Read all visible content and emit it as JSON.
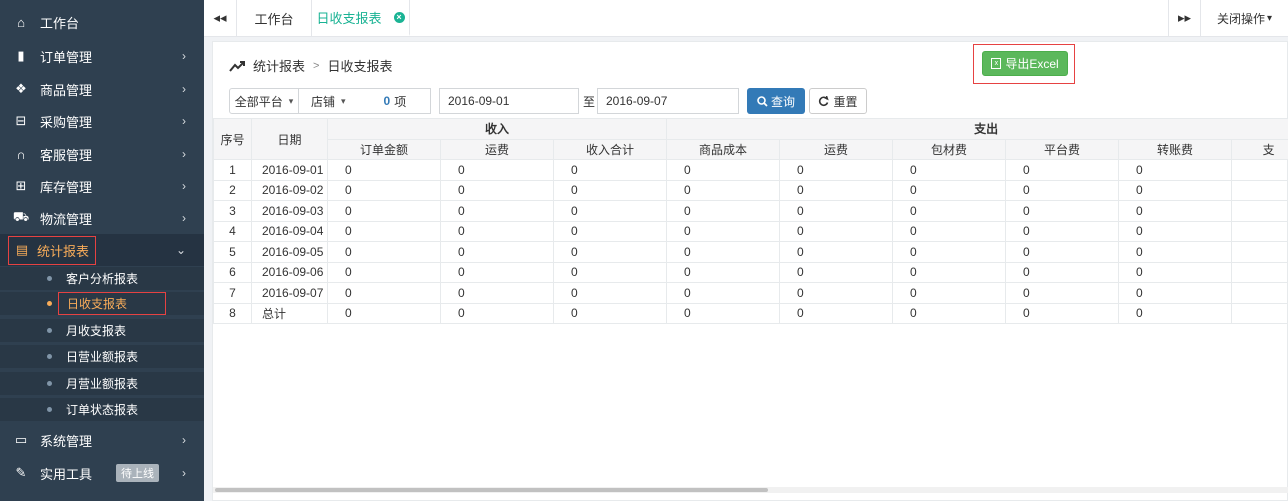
{
  "sidebar": {
    "items": [
      {
        "label": "工作台",
        "icon": "home-icon",
        "glyph": "⌂",
        "has_arrow": false
      },
      {
        "label": "订单管理",
        "icon": "clipboard-icon",
        "glyph": "▮",
        "has_arrow": true,
        "arrow": "›"
      },
      {
        "label": "商品管理",
        "icon": "gift-icon",
        "glyph": "❖",
        "has_arrow": true,
        "arrow": "›"
      },
      {
        "label": "采购管理",
        "icon": "cart-icon",
        "glyph": "⊟",
        "has_arrow": true,
        "arrow": "›"
      },
      {
        "label": "客服管理",
        "icon": "headphones-icon",
        "glyph": "∩",
        "has_arrow": true,
        "arrow": "›"
      },
      {
        "label": "库存管理",
        "icon": "inbox-icon",
        "glyph": "⊞",
        "has_arrow": true,
        "arrow": "›"
      },
      {
        "label": "物流管理",
        "icon": "truck-icon",
        "glyph": "⛟",
        "has_arrow": true,
        "arrow": "›"
      },
      {
        "label": "统计报表",
        "icon": "report-icon",
        "glyph": "▤",
        "has_arrow": true,
        "arrow": "⌄",
        "active": true
      }
    ],
    "subitems": [
      {
        "label": "客户分析报表"
      },
      {
        "label": "日收支报表",
        "active": true
      },
      {
        "label": "月收支报表"
      },
      {
        "label": "日营业额报表"
      },
      {
        "label": "月营业额报表"
      },
      {
        "label": "订单状态报表"
      }
    ],
    "bottom_items": [
      {
        "label": "系统管理",
        "icon": "monitor-icon",
        "glyph": "▭",
        "arrow": "›"
      },
      {
        "label": "实用工具",
        "icon": "wrench-icon",
        "glyph": "✎",
        "arrow": "›",
        "badge": "待上线"
      }
    ]
  },
  "topbar": {
    "back_glyph": "◂◂",
    "forward_glyph": "▸▸",
    "tabs": [
      {
        "label": "工作台"
      },
      {
        "label": "日收支报表",
        "close_glyph": "×"
      }
    ],
    "close_ops_label": "关闭操作",
    "close_ops_caret": "▾"
  },
  "breadcrumb": {
    "parent": "统计报表",
    "separator": ">",
    "current": "日收支报表"
  },
  "export": {
    "label": "导出Excel",
    "icon_glyph": "x"
  },
  "filters": {
    "platform": "全部平台",
    "shop": "店铺",
    "shop_count": "0",
    "shop_count_unit": "项",
    "date_from": "2016-09-01",
    "to_label": "至",
    "date_to": "2016-09-07",
    "search_label": "查询",
    "reset_label": "重置",
    "caret": "▾"
  },
  "table": {
    "col_seq": "序号",
    "col_date": "日期",
    "group_income": "收入",
    "group_expense": "支出",
    "income_cols": [
      "订单金额",
      "运费",
      "收入合计"
    ],
    "expense_cols": [
      "商品成本",
      "运费",
      "包材费",
      "平台费",
      "转账费",
      "支"
    ],
    "rows": [
      {
        "seq": "1",
        "date": "2016-09-01",
        "vals": [
          "0",
          "0",
          "0",
          "0",
          "0",
          "0",
          "0",
          "0"
        ]
      },
      {
        "seq": "2",
        "date": "2016-09-02",
        "vals": [
          "0",
          "0",
          "0",
          "0",
          "0",
          "0",
          "0",
          "0"
        ]
      },
      {
        "seq": "3",
        "date": "2016-09-03",
        "vals": [
          "0",
          "0",
          "0",
          "0",
          "0",
          "0",
          "0",
          "0"
        ]
      },
      {
        "seq": "4",
        "date": "2016-09-04",
        "vals": [
          "0",
          "0",
          "0",
          "0",
          "0",
          "0",
          "0",
          "0"
        ]
      },
      {
        "seq": "5",
        "date": "2016-09-05",
        "vals": [
          "0",
          "0",
          "0",
          "0",
          "0",
          "0",
          "0",
          "0"
        ]
      },
      {
        "seq": "6",
        "date": "2016-09-06",
        "vals": [
          "0",
          "0",
          "0",
          "0",
          "0",
          "0",
          "0",
          "0"
        ]
      },
      {
        "seq": "7",
        "date": "2016-09-07",
        "vals": [
          "0",
          "0",
          "0",
          "0",
          "0",
          "0",
          "0",
          "0"
        ]
      },
      {
        "seq": "8",
        "date": "总计",
        "vals": [
          "0",
          "0",
          "0",
          "0",
          "0",
          "0",
          "0",
          "0"
        ]
      }
    ]
  },
  "colors": {
    "sidebar_bg": "#2f4050",
    "accent_active": "#f8ac59",
    "tab_active": "#1ab394",
    "highlight_border": "#e64242",
    "export_green": "#5cb85c",
    "search_blue": "#337ab7"
  }
}
